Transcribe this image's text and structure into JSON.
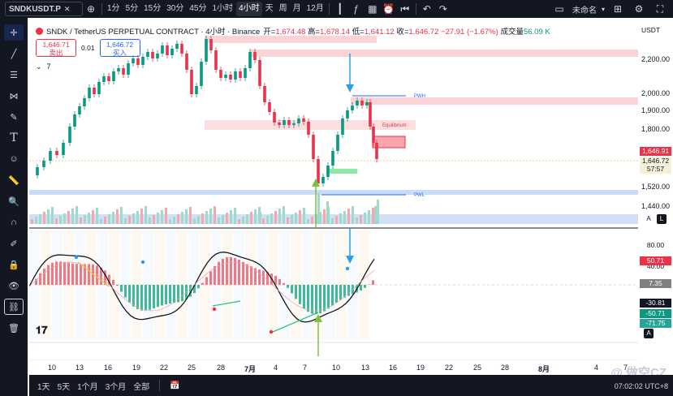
{
  "toolbar": {
    "symbol": "SNDKUSDT.P",
    "timeframes": [
      "1分",
      "5分",
      "15分",
      "30分",
      "45分",
      "1小时",
      "4小时",
      "天",
      "周",
      "月",
      "12月"
    ],
    "active_timeframe": "4小时",
    "layout_name": "未命名"
  },
  "legend": {
    "title": "SNDK / TetherUS PERPETUAL CONTRACT · 4小时 · Binance",
    "open_label": "开=",
    "open": "1,674.48",
    "high_label": "高=",
    "high": "1,678.14",
    "low_label": "低=",
    "low": "1,641.12",
    "close_label": "收=",
    "close": "1,646.72",
    "change": "−27.91 (−1.67%)",
    "volume_label": "成交量",
    "volume": "56.09 K"
  },
  "bid_ask": {
    "sell_price": "1,646.71",
    "sell_label": "卖出",
    "spread": "0.01",
    "buy_price": "1,646.72",
    "buy_label": "买入"
  },
  "indicators_count": "7",
  "currency": "USDT",
  "price_axis": {
    "labels": [
      "2,200.00",
      "2,000.00",
      "1,900.00",
      "1,800.00",
      "1,520.00",
      "1,440.00"
    ],
    "tag_last": "1,646.91",
    "tag_close": "1,646.72",
    "tag_countdown": "57:57"
  },
  "osc_axis": {
    "labels": [
      "80.00",
      "40.00"
    ],
    "tag_1": "50.71",
    "tag_2": "7.35",
    "tag_3": "-30.81",
    "tag_4": "-50.71",
    "tag_5": "-71.75"
  },
  "annotations": {
    "pwh": "PWH",
    "pwl": "PWL",
    "equilibrium": "Equilibrium",
    "eql": "EQL"
  },
  "date_axis": [
    "10",
    "13",
    "16",
    "19",
    "22",
    "25",
    "28",
    "7月",
    "4",
    "7",
    "10",
    "13",
    "16",
    "19",
    "22",
    "25",
    "28",
    "8月",
    "4",
    "7"
  ],
  "range_buttons": [
    "1天",
    "5天",
    "1个月",
    "3个月",
    "全部"
  ],
  "timezone": "07:02:02 UTC+8",
  "watermark": "@ 做空CZ",
  "colors": {
    "up": "#089981",
    "down": "#e8334a",
    "accent": "#2962ff",
    "dark_bg": "#131722"
  }
}
